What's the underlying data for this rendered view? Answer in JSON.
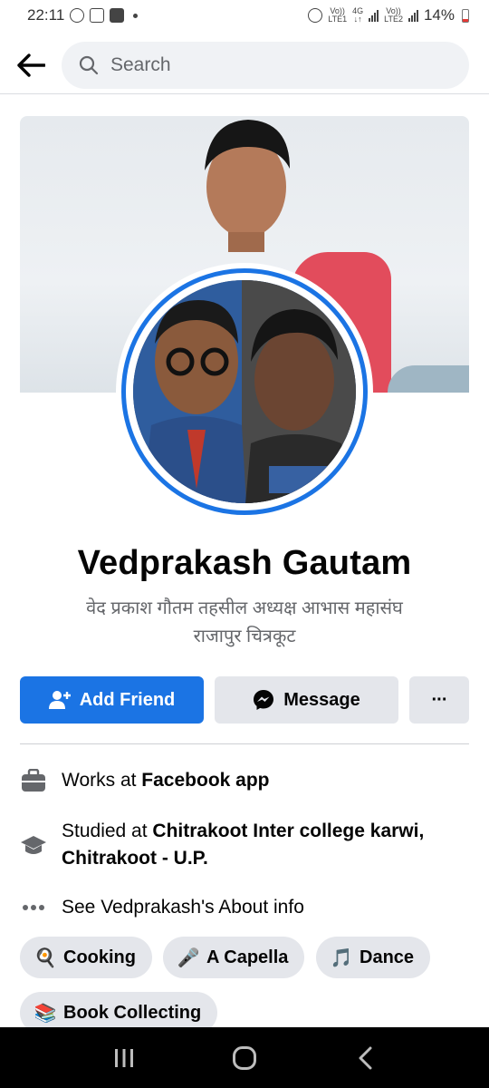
{
  "status_bar": {
    "time": "22:11",
    "battery_percent": "14%",
    "icons": [
      "whatsapp-icon",
      "gallery-icon",
      "youtube-icon",
      "dot-icon",
      "alarm-icon",
      "signal-icon",
      "battery-icon"
    ],
    "sim1_label_top": "Vo))",
    "sim1_label_bottom": "LTE1",
    "network_label_top": "4G",
    "network_label_bottom": "↓↑",
    "sim2_label_top": "Vo))",
    "sim2_label_bottom": "LTE2"
  },
  "top_bar": {
    "search_placeholder": "Search"
  },
  "profile": {
    "name": "Vedprakash Gautam",
    "bio_line1": "वेद प्रकाश गौतम तहसील अध्यक्ष आभास महासंघ",
    "bio_line2": "राजापुर चित्रकूट"
  },
  "actions": {
    "add_friend": "Add Friend",
    "message": "Message",
    "more": "···"
  },
  "intro": {
    "work_prefix": "Works at ",
    "work_place": "Facebook app",
    "study_prefix": "Studied at ",
    "study_place": "Chitrakoot Inter college karwi, Chitrakoot - U.P.",
    "about_link": "See Vedprakash's About info"
  },
  "hobbies": [
    {
      "label": "Cooking",
      "emoji": "🍳"
    },
    {
      "label": "A Capella",
      "emoji": "🎤"
    },
    {
      "label": "Dance",
      "emoji": "🎵"
    },
    {
      "label": "Book Collecting",
      "emoji": "📚"
    }
  ],
  "colors": {
    "accent": "#1b74e4",
    "button_gray": "#e4e6eb",
    "secondary_text": "#65676b"
  }
}
